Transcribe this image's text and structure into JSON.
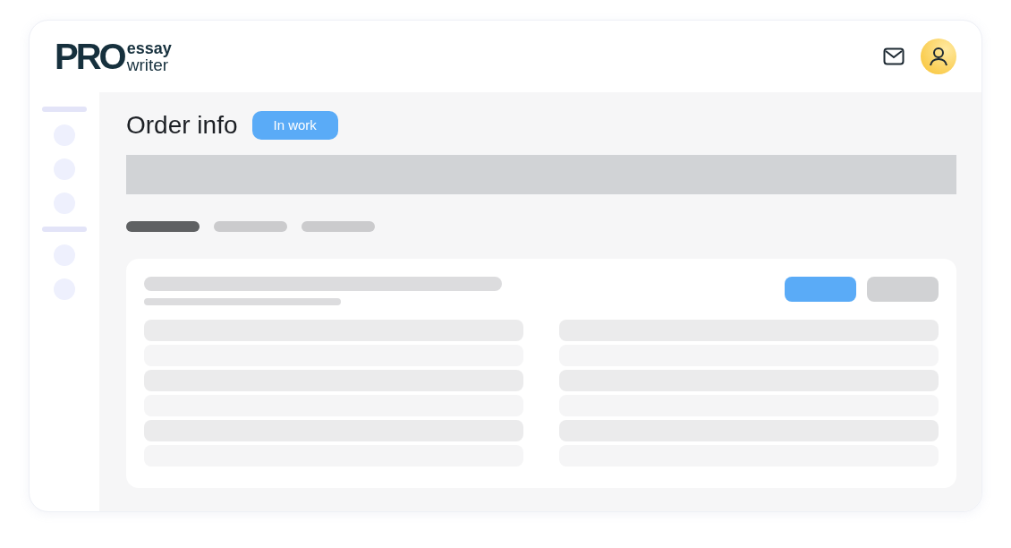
{
  "logo": {
    "mark": "PRO",
    "top": "essay",
    "bottom": "writer"
  },
  "page": {
    "title": "Order info",
    "status": "In work"
  },
  "tabs": [
    {
      "selected": true
    },
    {
      "selected": false
    },
    {
      "selected": false
    }
  ]
}
